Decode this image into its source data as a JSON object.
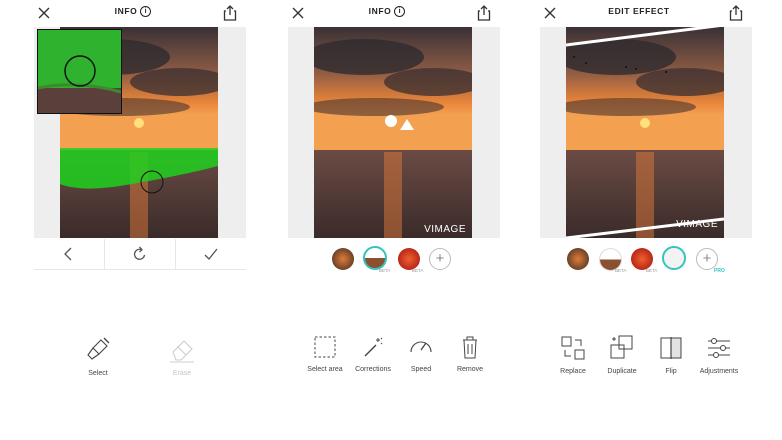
{
  "panels": [
    {
      "title": "INFO",
      "nav": [
        "back",
        "rotate",
        "confirm"
      ],
      "tools": [
        {
          "label": "Select",
          "icon": "brush-icon",
          "enabled": true
        },
        {
          "label": "Erase",
          "icon": "eraser-icon",
          "enabled": false
        }
      ]
    },
    {
      "title": "INFO",
      "watermark": "VIMAGE",
      "effects": [
        {
          "name": "fireworks-thumb",
          "beta": ""
        },
        {
          "name": "water-thumb",
          "beta": "BETA"
        },
        {
          "name": "fire-thumb",
          "beta": "BETA"
        }
      ],
      "tools": [
        {
          "label": "Select area",
          "icon": "dashed-square-icon"
        },
        {
          "label": "Corrections",
          "icon": "magic-wand-icon"
        },
        {
          "label": "Speed",
          "icon": "speedometer-icon"
        },
        {
          "label": "Remove",
          "icon": "trash-icon"
        }
      ]
    },
    {
      "title": "EDIT EFFECT",
      "watermark": "VIMAGE",
      "effects": [
        {
          "name": "fireworks-thumb",
          "beta": ""
        },
        {
          "name": "water-thumb",
          "beta": "BETA"
        },
        {
          "name": "fire-thumb",
          "beta": "BETA"
        },
        {
          "name": "sparkle-thumb",
          "beta": ""
        }
      ],
      "pro_label": "PRO",
      "tools": [
        {
          "label": "Replace",
          "icon": "replace-icon"
        },
        {
          "label": "Duplicate",
          "icon": "duplicate-icon"
        },
        {
          "label": "Flip",
          "icon": "flip-icon"
        },
        {
          "label": "Adjustments",
          "icon": "sliders-icon"
        }
      ]
    }
  ],
  "colors": {
    "accent": "#33c4c0",
    "selection": "#1fd11f",
    "sky_top": "#4a3a3a",
    "sun": "#ffcf5a"
  }
}
